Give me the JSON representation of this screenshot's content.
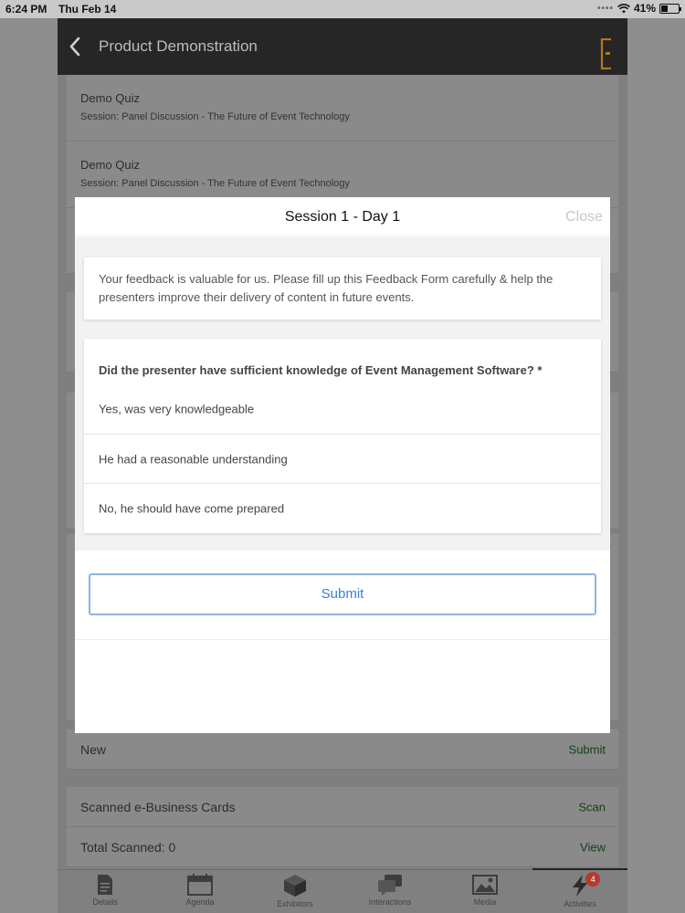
{
  "status_bar": {
    "time": "6:24 PM",
    "date": "Thu Feb 14",
    "battery": "41%",
    "battery_level": 0.41
  },
  "app": {
    "title": "Product Demonstration",
    "back_icon": "chevron-left-icon",
    "brand_color": "#d98c1e"
  },
  "background": {
    "cards": [
      {
        "title": "Demo Quiz",
        "subtitle": "Session: Panel Discussion - The Future of Event Technology"
      },
      {
        "title": "Demo Quiz",
        "subtitle": "Session: Panel Discussion - The Future of Event Technology"
      }
    ],
    "new_row": {
      "label": "New",
      "action": "Submit"
    },
    "scanned_cards": {
      "label": "Scanned e-Business Cards",
      "action": "Scan"
    },
    "total_scanned": {
      "label": "Total Scanned: 0",
      "action": "View"
    }
  },
  "tabs": [
    {
      "label": "Details",
      "icon": "document-icon"
    },
    {
      "label": "Agenda",
      "icon": "calendar-icon"
    },
    {
      "label": "Exhibitors",
      "icon": "cube-icon"
    },
    {
      "label": "Interactions",
      "icon": "chat-bubbles-icon"
    },
    {
      "label": "Media",
      "icon": "image-icon"
    },
    {
      "label": "Activities",
      "icon": "lightning-icon",
      "badge": "4",
      "active": true
    }
  ],
  "modal": {
    "title": "Session 1 - Day 1",
    "close_label": "Close",
    "intro": "Your feedback is valuable for us. Please fill up this Feedback Form carefully & help the presenters improve their delivery of content in future events.",
    "question": "Did the presenter have sufficient knowledge of Event Management Software? *",
    "options": [
      "Yes, was very knowledgeable",
      "He had a reasonable understanding",
      "No, he should have come prepared"
    ],
    "submit_label": "Submit",
    "accent_color": "#3b7fd0"
  }
}
